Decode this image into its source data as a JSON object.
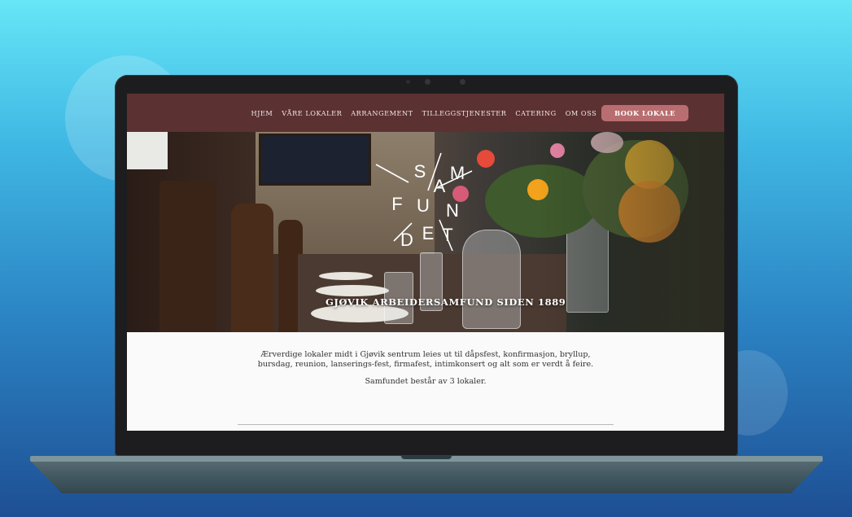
{
  "nav": {
    "items": [
      "HJEM",
      "VÅRE LOKALER",
      "ARRANGEMENT",
      "TILLEGGSTJENESTER",
      "CATERING",
      "OM OSS"
    ],
    "cta_label": "BOOK LOKALE"
  },
  "hero": {
    "logo_letters": [
      "S",
      "A",
      "M",
      "F",
      "U",
      "N",
      "D",
      "E",
      "T"
    ],
    "tagline": "GJØVIK ARBEIDERSAMFUND SIDEN 1889"
  },
  "content": {
    "intro_line1": "Ærverdige lokaler midt i Gjøvik sentrum leies ut til dåpsfest, konfirmasjon, bryllup,",
    "intro_line2": "bursdag, reunion, lanserings-fest, firmafest, intimkonsert og alt som er verdt å feire.",
    "venue_count": "Samfundet består av 3 lokaler."
  },
  "colors": {
    "navbar": "#5b3132",
    "cta": "#b86e70",
    "background_top": "#66e6f7",
    "background_bottom": "#1e4f94"
  }
}
